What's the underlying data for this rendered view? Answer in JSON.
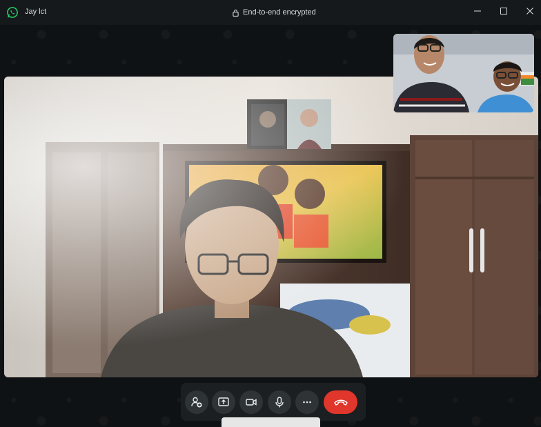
{
  "window": {
    "contact_name": "Jay lct",
    "encryption_status": "End-to-end encrypted",
    "app_icon": "whatsapp-icon",
    "window_controls": [
      "minimize-icon",
      "maximize-icon",
      "close-icon"
    ]
  },
  "call_controls": {
    "buttons": [
      {
        "name": "add-participant-button",
        "icon": "add-person-icon"
      },
      {
        "name": "share-screen-button",
        "icon": "share-screen-icon"
      },
      {
        "name": "video-toggle-button",
        "icon": "video-camera-icon"
      },
      {
        "name": "mute-button",
        "icon": "microphone-icon"
      },
      {
        "name": "more-options-button",
        "icon": "more-horizontal-icon"
      }
    ],
    "end_call": {
      "name": "end-call-button",
      "icon": "phone-hangup-icon",
      "color": "#e0362b"
    }
  },
  "colors": {
    "titlebar": "#15191b",
    "control_bar": "#1c1f21",
    "control_button": "#2e3336",
    "end_call": "#e0362b",
    "brand": "#25d366"
  }
}
